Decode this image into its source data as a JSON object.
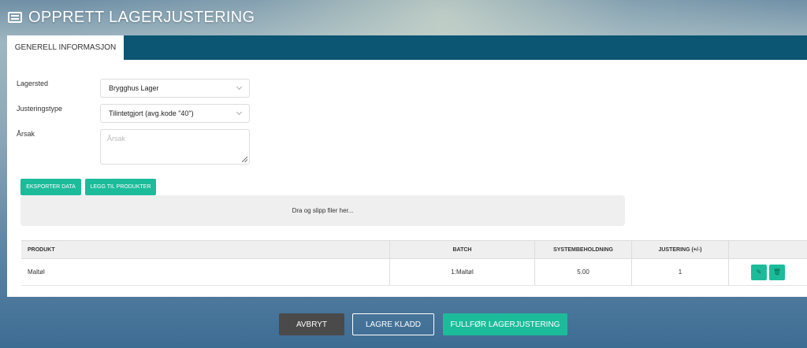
{
  "header": {
    "title": "OPPRETT LAGERJUSTERING",
    "icon": "list-icon"
  },
  "tabs": [
    {
      "label": "GENERELL INFORMASJON",
      "active": true
    }
  ],
  "form": {
    "lagersted_label": "Lagersted",
    "lagersted_value": "Brygghus Lager",
    "justeringstype_label": "Justeringstype",
    "justeringstype_value": "Tilintetgjort (avg.kode \"40\")",
    "arsak_label": "Årsak",
    "arsak_placeholder": "Årsak"
  },
  "actions": {
    "export_label": "EKSPORTER DATA",
    "add_products_label": "LEGG TIL PRODUKTER"
  },
  "dropzone": {
    "text": "Dra og slipp filer her..."
  },
  "table": {
    "headers": [
      "PRODUKT",
      "BATCH",
      "SYSTEMBEHOLDNING",
      "JUSTERING (+/-)"
    ],
    "rows": [
      {
        "product": "Maltøl",
        "batch": "1:Maltøl",
        "system": "5.00",
        "adjustment": "1"
      }
    ]
  },
  "footer": {
    "cancel_label": "AVBRYT",
    "save_draft_label": "LAGRE KLADD",
    "complete_label": "FULLFØR LAGERJUSTERING"
  },
  "colors": {
    "accent": "#1cbc9b",
    "tabbar": "#0c5573",
    "cancel": "#4a4a4a"
  }
}
